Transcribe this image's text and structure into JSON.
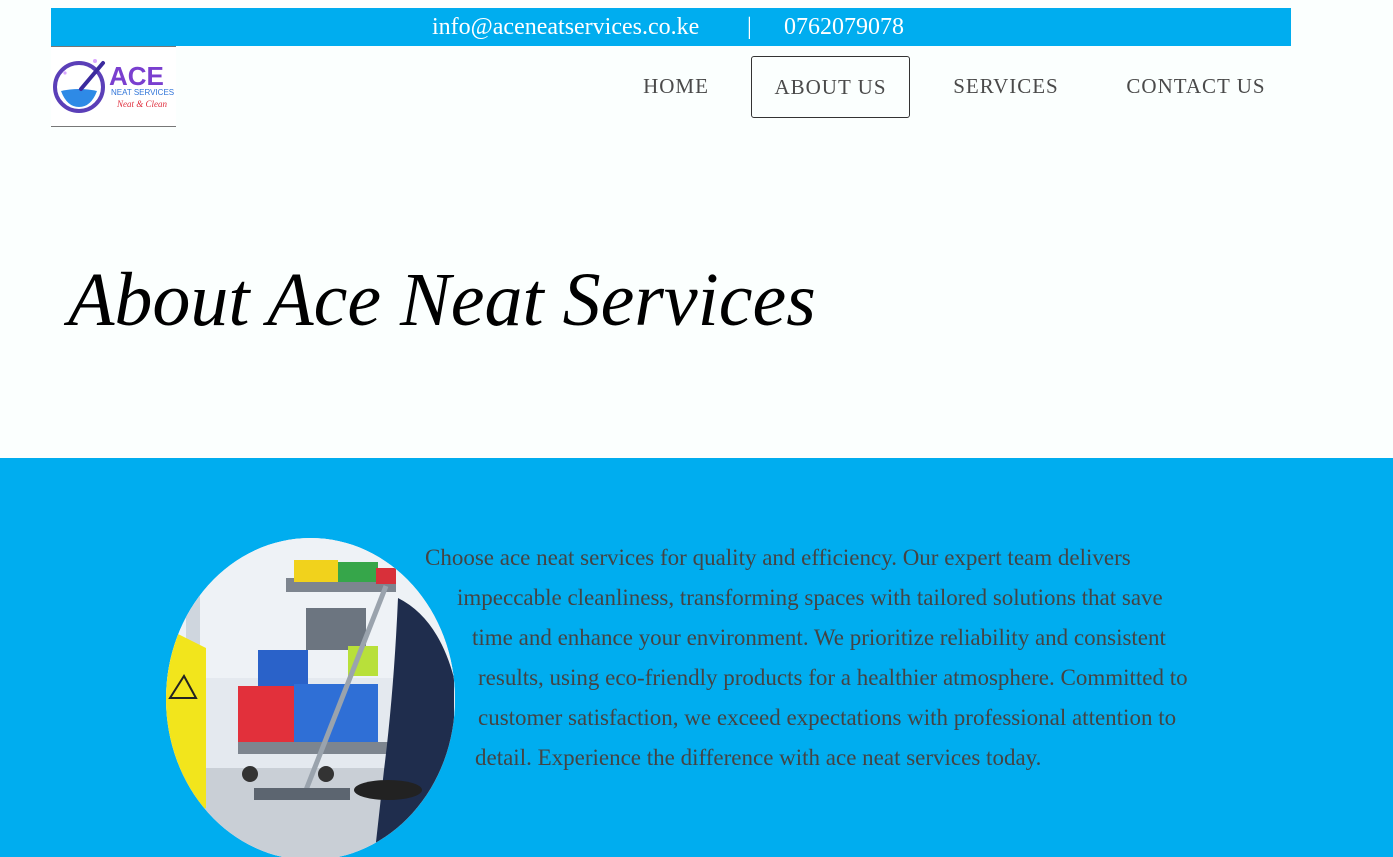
{
  "topbar": {
    "email": "info@aceneatservices.co.ke",
    "separator": "|",
    "phone": "0762079078"
  },
  "logo": {
    "brand": "ACE",
    "subtitle": "NEAT SERVICES",
    "tagline": "Neat & Clean"
  },
  "nav": {
    "items": [
      "HOME",
      "ABOUT US",
      "SERVICES",
      "CONTACT US"
    ],
    "active": "ABOUT US"
  },
  "hero": {
    "title": "About Ace Neat Services"
  },
  "about": {
    "lines": [
      "Choose ace neat services for quality and efficiency. Our expert team delivers",
      "impeccable cleanliness, transforming spaces with tailored solutions that save",
      "time and enhance your environment. We prioritize reliability and consistent",
      "results, using eco-friendly products for a healthier atmosphere. Committed to",
      "customer satisfaction, we exceed expectations with professional attention to",
      "detail. Experience the difference with ace neat services today."
    ]
  },
  "colors": {
    "accent": "#00adef",
    "page_background": "#fbfffe",
    "body_text": "#444444",
    "nav_text": "#4a4a4a"
  }
}
